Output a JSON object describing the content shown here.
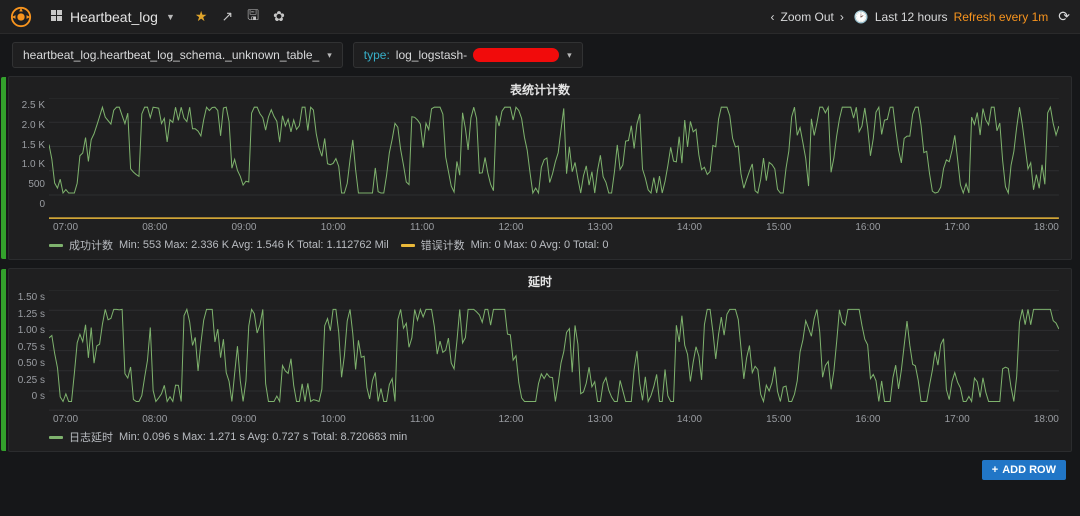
{
  "header": {
    "dashboard_name": "Heartbeat_log",
    "zoom_label": "Zoom Out",
    "timerange_label": "Last 12 hours",
    "refresh_label": "Refresh every 1m"
  },
  "vars": {
    "table": "heartbeat_log.heartbeat_log_schema._unknown_table_",
    "type_key": "type:",
    "type_val": "log_logstash-"
  },
  "panel1": {
    "title": "表统计计数",
    "y_ticks": [
      "2.5 K",
      "2.0 K",
      "1.5 K",
      "1.0 K",
      "500",
      "0"
    ],
    "x_ticks": [
      "07:00",
      "08:00",
      "09:00",
      "10:00",
      "11:00",
      "12:00",
      "13:00",
      "14:00",
      "15:00",
      "16:00",
      "17:00",
      "18:00"
    ],
    "legend": [
      {
        "color": "green",
        "name": "成功计数",
        "stats": "Min: 553  Max: 2.336 K  Avg: 1.546 K  Total: 1.112762 Mil"
      },
      {
        "color": "orange",
        "name": "错误计数",
        "stats": "Min: 0  Max: 0  Avg: 0  Total: 0"
      }
    ]
  },
  "panel2": {
    "title": "延时",
    "y_ticks": [
      "1.50 s",
      "1.25 s",
      "1.00 s",
      "0.75 s",
      "0.50 s",
      "0.25 s",
      "0 s"
    ],
    "x_ticks": [
      "07:00",
      "08:00",
      "09:00",
      "10:00",
      "11:00",
      "12:00",
      "13:00",
      "14:00",
      "15:00",
      "16:00",
      "17:00",
      "18:00"
    ],
    "legend": [
      {
        "color": "green",
        "name": "日志延时",
        "stats": "Min: 0.096 s  Max: 1.271 s  Avg: 0.727 s  Total: 8.720683 min"
      }
    ]
  },
  "add_row_label": "ADD ROW",
  "chart_data": [
    {
      "type": "line",
      "title": "表统计计数",
      "xlabel": "",
      "ylabel": "",
      "x_range": [
        "07:00",
        "19:00"
      ],
      "ylim": [
        0,
        2500
      ],
      "series": [
        {
          "name": "成功计数",
          "color": "#7eb26d",
          "approx_values_note": "dense minute-level series oscillating roughly between 900 and 2200 with spikes up to ~2336 and dips to ~553; avg ≈ 1546, total ≈ 1.112762M over 12h"
        },
        {
          "name": "错误计数",
          "color": "#eab839",
          "constant": 0
        }
      ]
    },
    {
      "type": "line",
      "title": "延时",
      "xlabel": "",
      "ylabel": "",
      "x_range": [
        "07:00",
        "19:00"
      ],
      "ylim": [
        0,
        1.5
      ],
      "series": [
        {
          "name": "日志延时",
          "color": "#7eb26d",
          "approx_values_note": "dense minute-level series oscillating roughly between 0.2s and 1.2s with peaks to ~1.271s and dips to ~0.096s; avg ≈ 0.727s, total ≈ 8.720683 min over 12h"
        }
      ]
    }
  ]
}
